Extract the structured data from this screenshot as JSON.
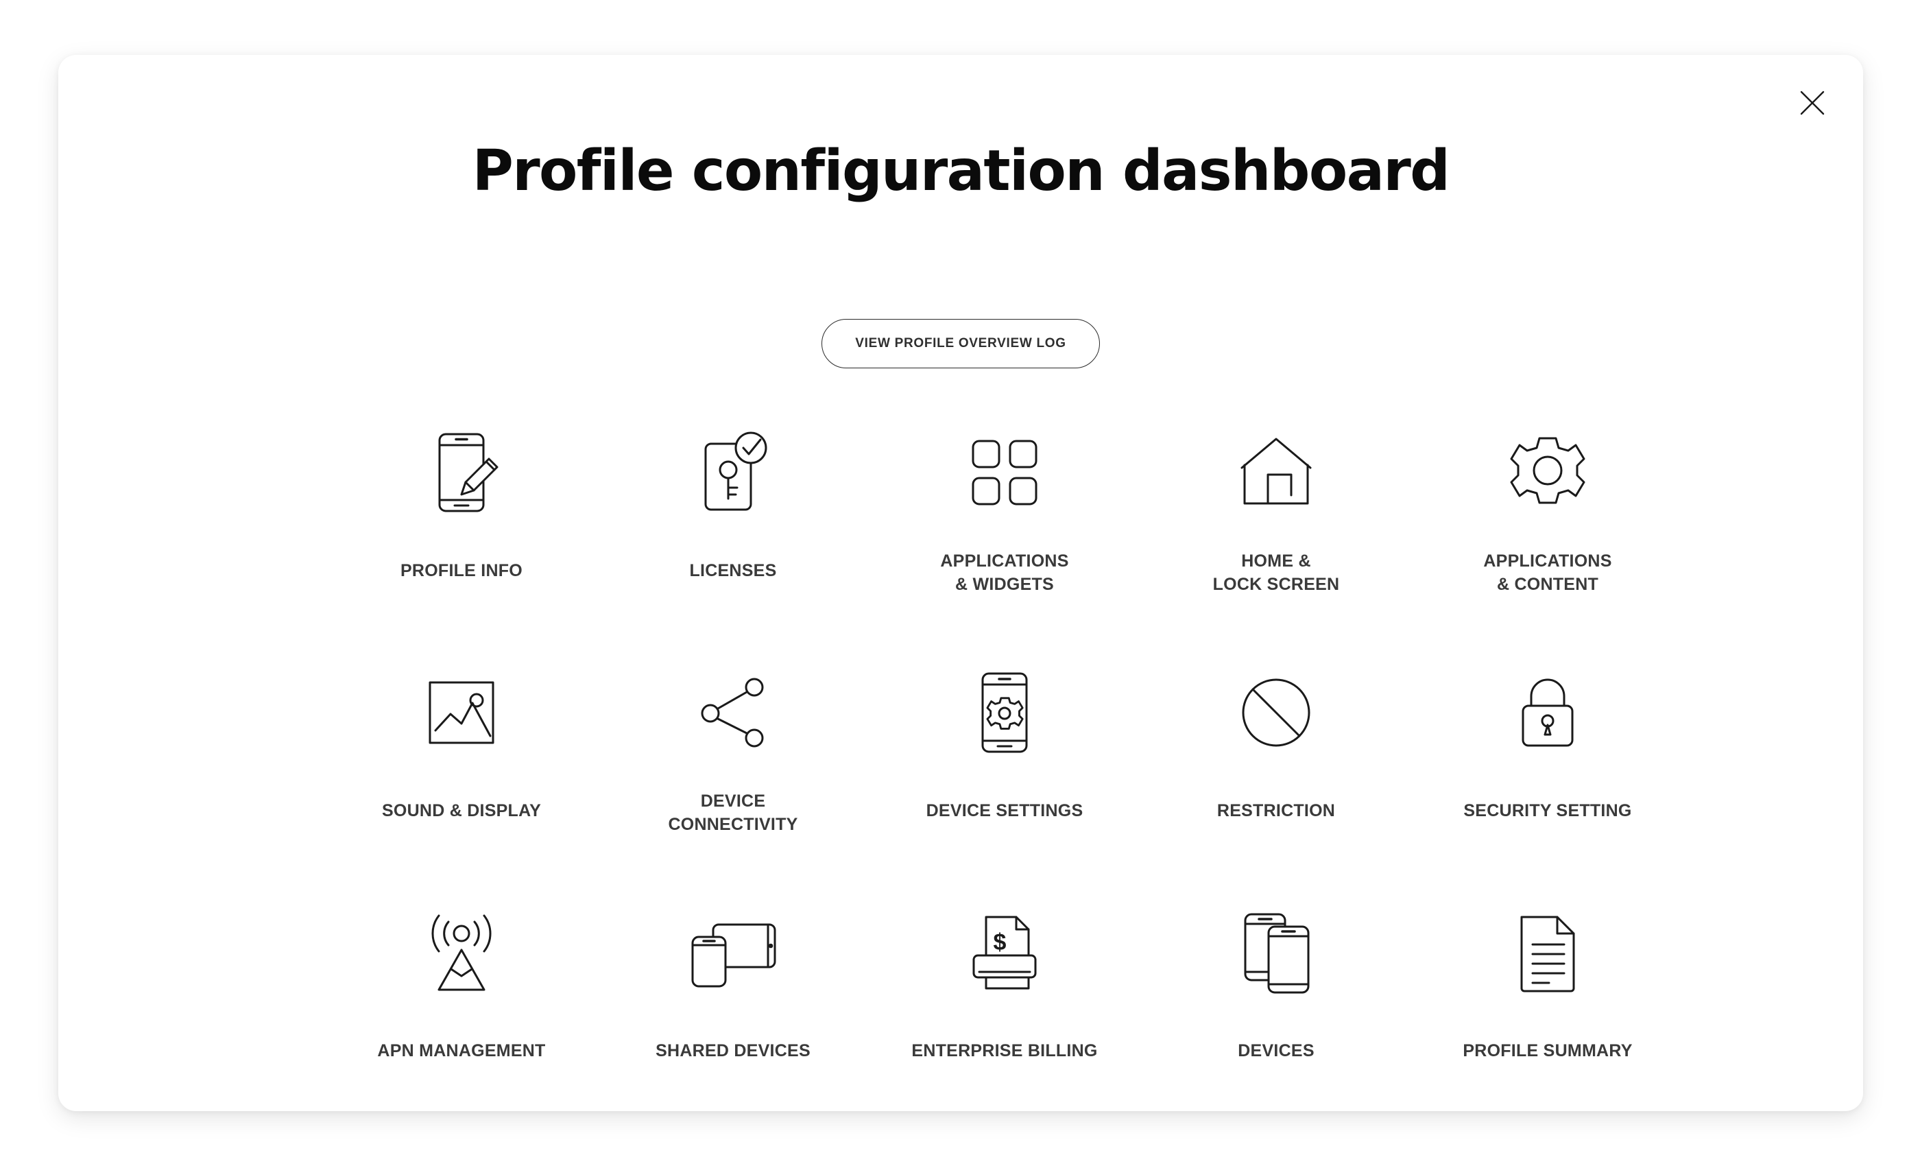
{
  "dialog": {
    "title": "Profile configuration dashboard",
    "close_label": "Close",
    "close_icon": "close-icon"
  },
  "action": {
    "view_log_label": "VIEW PROFILE OVERVIEW LOG"
  },
  "colors": {
    "page_background": "#ffffff",
    "card_background": "#ffffff",
    "title_text": "#0b0b0b",
    "label_text": "#3a3a3a",
    "icon_stroke": "#1a1a1a",
    "button_border": "#2b2b2b"
  },
  "tiles": [
    {
      "label": "PROFILE INFO",
      "icon": "phone-pencil-icon",
      "lines": 1
    },
    {
      "label": "LICENSES",
      "icon": "key-card-check-icon",
      "lines": 1
    },
    {
      "label": "APPLICATIONS\n& WIDGETS",
      "icon": "grid-squares-icon",
      "lines": 2
    },
    {
      "label": "HOME &\nLOCK SCREEN",
      "icon": "house-icon",
      "lines": 2
    },
    {
      "label": "APPLICATIONS\n& CONTENT",
      "icon": "gear-icon",
      "lines": 2
    },
    {
      "label": "SOUND & DISPLAY",
      "icon": "image-picture-icon",
      "lines": 1
    },
    {
      "label": "DEVICE\nCONNECTIVITY",
      "icon": "share-nodes-icon",
      "lines": 2
    },
    {
      "label": "DEVICE SETTINGS",
      "icon": "phone-gear-icon",
      "lines": 1
    },
    {
      "label": "RESTRICTION",
      "icon": "prohibition-icon",
      "lines": 1
    },
    {
      "label": "SECURITY SETTING",
      "icon": "padlock-icon",
      "lines": 1
    },
    {
      "label": "APN MANAGEMENT",
      "icon": "broadcast-tower-icon",
      "lines": 1
    },
    {
      "label": "SHARED DEVICES",
      "icon": "tablet-phone-icon",
      "lines": 1
    },
    {
      "label": "ENTERPRISE BILLING",
      "icon": "invoice-dollar-icon",
      "lines": 1
    },
    {
      "label": "DEVICES",
      "icon": "two-phones-icon",
      "lines": 1
    },
    {
      "label": "PROFILE SUMMARY",
      "icon": "document-lines-icon",
      "lines": 1
    }
  ]
}
